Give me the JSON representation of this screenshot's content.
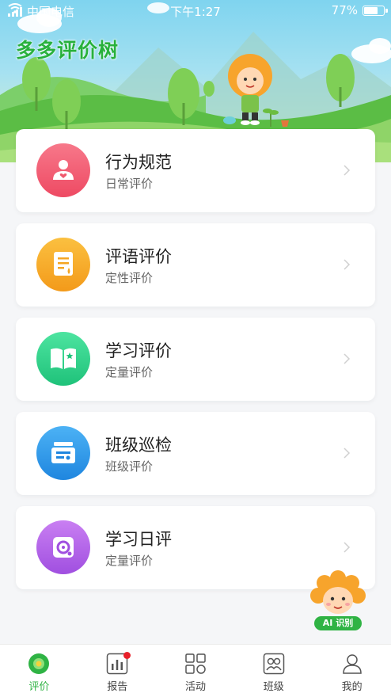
{
  "status_bar": {
    "carrier": "中国电信",
    "time": "下午1:27",
    "battery": "77%",
    "battery_level": 0.77
  },
  "header": {
    "title": "多多评价树"
  },
  "cards": [
    {
      "title": "行为规范",
      "subtitle": "日常评价",
      "icon": "person-heart-icon",
      "color": "#f0596e"
    },
    {
      "title": "评语评价",
      "subtitle": "定性评价",
      "icon": "document-icon",
      "color": "#f7a928"
    },
    {
      "title": "学习评价",
      "subtitle": "定量评价",
      "icon": "book-star-icon",
      "color": "#2fd28a"
    },
    {
      "title": "班级巡检",
      "subtitle": "班级评价",
      "icon": "inspection-board-icon",
      "color": "#2b97ea"
    },
    {
      "title": "学习日评",
      "subtitle": "定量评价",
      "icon": "settings-gear-icon",
      "color": "#b25ee8"
    }
  ],
  "ai_badge": {
    "label": "AI 识别"
  },
  "tabbar": {
    "items": [
      {
        "label": "评价",
        "icon": "tree-icon",
        "active": true
      },
      {
        "label": "报告",
        "icon": "report-chart-icon",
        "badge": true
      },
      {
        "label": "活动",
        "icon": "grid-icon"
      },
      {
        "label": "班级",
        "icon": "class-icon"
      },
      {
        "label": "我的",
        "icon": "profile-icon"
      }
    ],
    "active_color": "#2fb344"
  }
}
